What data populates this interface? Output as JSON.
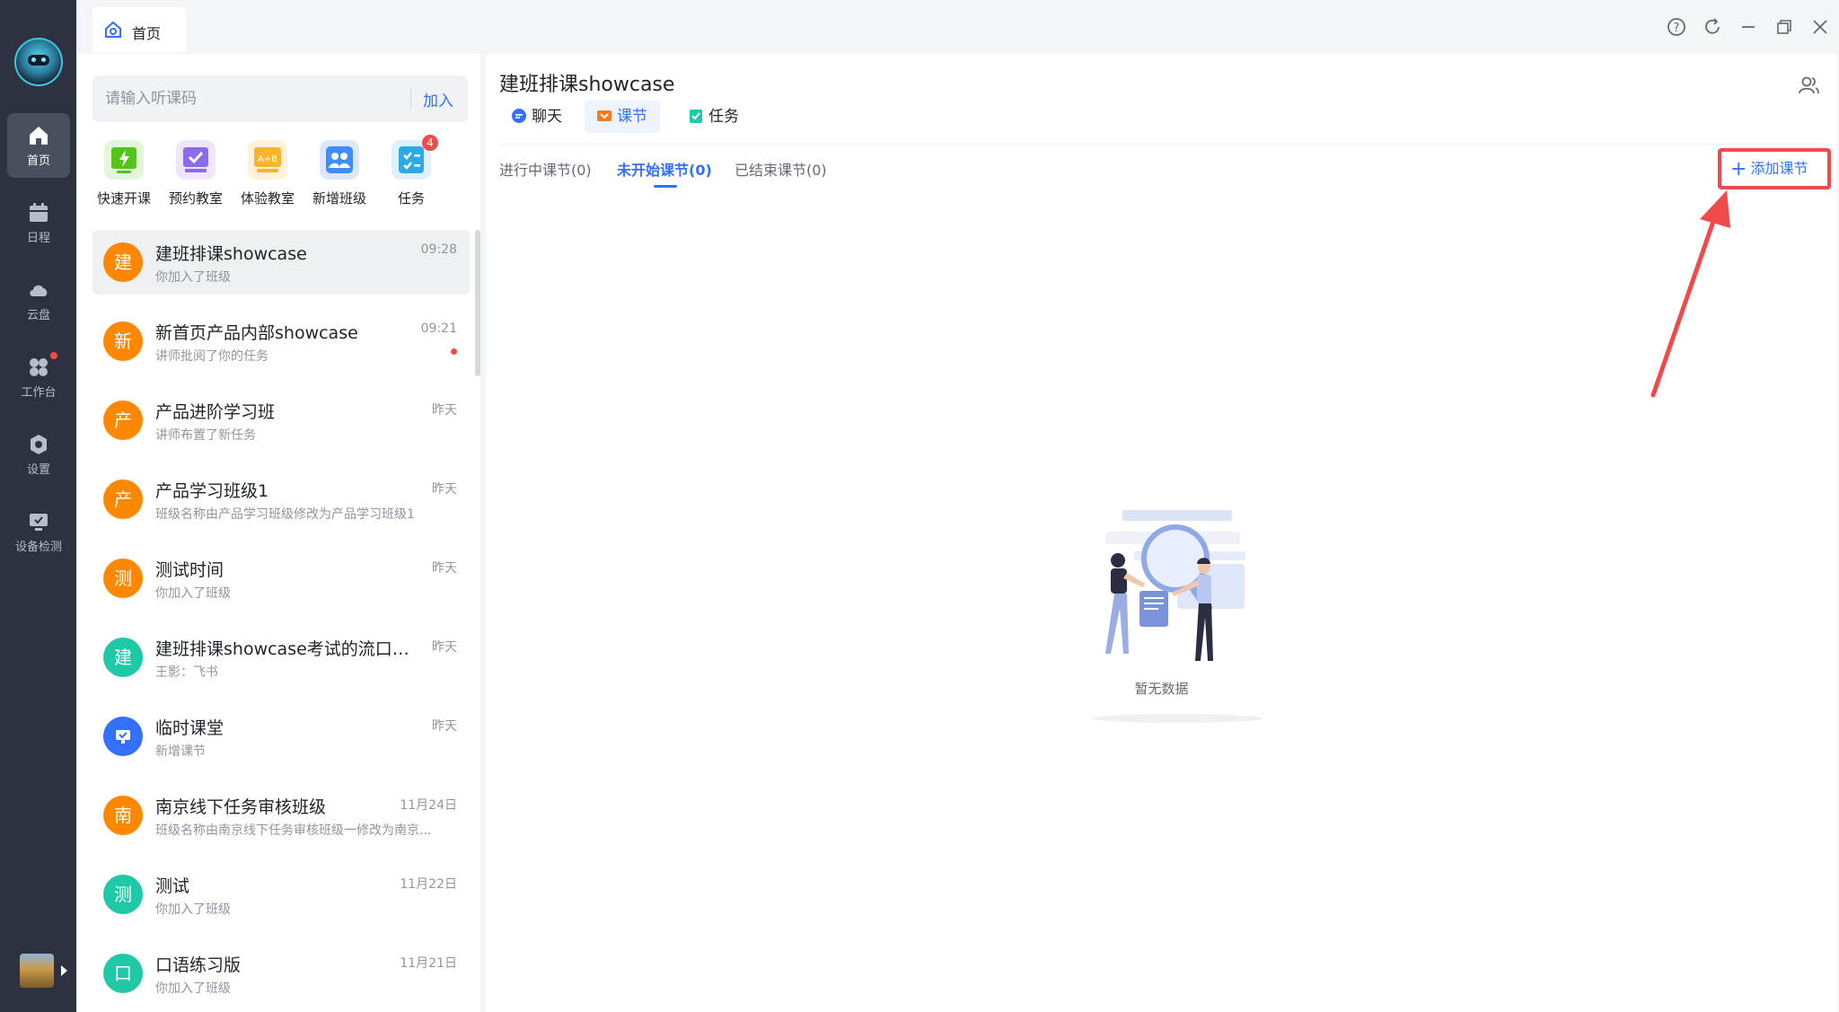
{
  "topbar": {
    "home_tab_label": "首页"
  },
  "rail": {
    "items": [
      {
        "label": "首页",
        "icon": "home-icon"
      },
      {
        "label": "日程",
        "icon": "calendar-icon"
      },
      {
        "label": "云盘",
        "icon": "cloud-icon"
      },
      {
        "label": "工作台",
        "icon": "workspace-icon"
      },
      {
        "label": "设置",
        "icon": "settings-icon"
      },
      {
        "label": "设备检测",
        "icon": "device-check-icon"
      }
    ]
  },
  "search": {
    "placeholder": "请输入听课码",
    "join_label": "加入"
  },
  "quick_actions": [
    {
      "label": "快速开课",
      "icon": "quick-start-icon"
    },
    {
      "label": "预约教室",
      "icon": "book-classroom-icon"
    },
    {
      "label": "体验教室",
      "icon": "trial-classroom-icon"
    },
    {
      "label": "新增班级",
      "icon": "add-class-icon"
    },
    {
      "label": "任务",
      "icon": "task-icon",
      "badge": "4"
    }
  ],
  "conversations": [
    {
      "avatar": "建",
      "color": "#ff8800",
      "title": "建班排课showcase",
      "subtitle": "你加入了班级",
      "time": "09:28"
    },
    {
      "avatar": "新",
      "color": "#ff8800",
      "title": "新首页产品内部showcase",
      "subtitle": "讲师批阅了你的任务",
      "time": "09:21"
    },
    {
      "avatar": "产",
      "color": "#ff8800",
      "title": "产品进阶学习班",
      "subtitle": "讲师布置了新任务",
      "time": "昨天"
    },
    {
      "avatar": "产",
      "color": "#ff8800",
      "title": "产品学习班级1",
      "subtitle": "班级名称由产品学习班级修改为产品学习班级1",
      "time": "昨天"
    },
    {
      "avatar": "测",
      "color": "#ff8800",
      "title": "测试时间",
      "subtitle": "你加入了班级",
      "time": "昨天"
    },
    {
      "avatar": "建",
      "color": "#1fc9a8",
      "title": "建班排课showcase考试的流口水...",
      "subtitle": "王影：飞书",
      "time": "昨天"
    },
    {
      "avatar": "",
      "color": "#3370ff",
      "title": "临时课堂",
      "subtitle": "新增课节",
      "time": "昨天"
    },
    {
      "avatar": "南",
      "color": "#ff8800",
      "title": "南京线下任务审核班级",
      "subtitle": "班级名称由南京线下任务审核班级一修改为南京...",
      "time": "11月24日"
    },
    {
      "avatar": "测",
      "color": "#1fc9a8",
      "title": "测试",
      "subtitle": "你加入了班级",
      "time": "11月22日"
    },
    {
      "avatar": "口",
      "color": "#1fc9a8",
      "title": "口语练习版",
      "subtitle": "你加入了班级",
      "time": "11月21日"
    }
  ],
  "content": {
    "title": "建班排课showcase",
    "tabs": [
      {
        "label": "聊天",
        "icon": "chat-icon"
      },
      {
        "label": "课节",
        "icon": "lesson-icon"
      },
      {
        "label": "任务",
        "icon": "task-icon"
      }
    ],
    "subtabs": [
      "进行中课节(0)",
      "未开始课节(0)",
      "已结束课节(0)"
    ],
    "add_lesson_label": "添加课节",
    "empty_text": "暂无数据"
  },
  "colors": {
    "accent": "#3370ff",
    "highlight": "#f04a4a",
    "orange_avatar": "#ff8800",
    "teal_avatar": "#1fc9a8"
  }
}
